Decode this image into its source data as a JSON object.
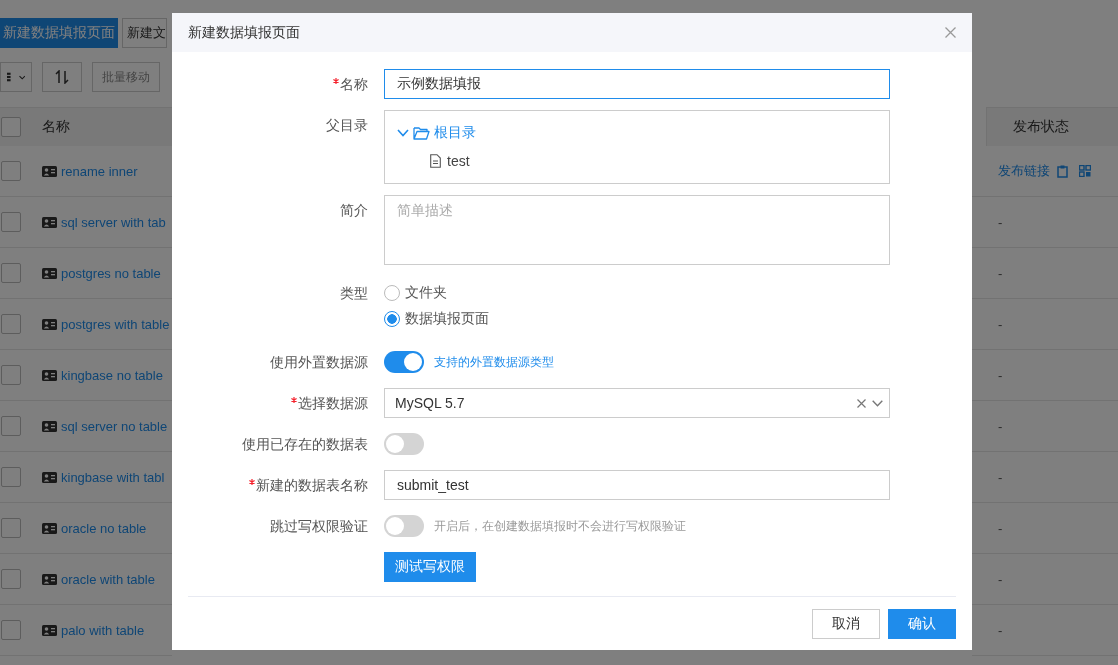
{
  "background": {
    "toolbar_buttons": [
      {
        "label": "新建数据填报页面",
        "kind": "primary"
      },
      {
        "label": "新建文",
        "kind": "default"
      }
    ],
    "action_buttons": [
      {
        "label": "批量移动"
      }
    ],
    "table": {
      "columns": [
        "名称",
        "发布状态"
      ],
      "all_checked": false,
      "rows": [
        {
          "name": "rename inner",
          "status": "发布链接",
          "published": true,
          "checked": false
        },
        {
          "name": "sql server with tab",
          "status": "-",
          "published": false,
          "checked": false
        },
        {
          "name": "postgres no table",
          "status": "-",
          "published": false,
          "checked": false
        },
        {
          "name": "postgres with table",
          "status": "-",
          "published": false,
          "checked": false
        },
        {
          "name": "kingbase no table",
          "status": "-",
          "published": false,
          "checked": false
        },
        {
          "name": "sql server no table",
          "status": "-",
          "published": false,
          "checked": false
        },
        {
          "name": "kingbase with tabl",
          "status": "-",
          "published": false,
          "checked": false
        },
        {
          "name": "oracle no table",
          "status": "-",
          "published": false,
          "checked": false
        },
        {
          "name": "oracle with table",
          "status": "-",
          "published": false,
          "checked": false
        },
        {
          "name": "palo with table",
          "status": "-",
          "published": false,
          "checked": false
        }
      ]
    }
  },
  "dialog": {
    "title": "新建数据填报页面",
    "fields": [
      {
        "kind": "input",
        "label": "名称",
        "required": true,
        "value": "示例数据填报",
        "focused": true
      },
      {
        "kind": "tree",
        "label": "父目录",
        "required": false,
        "tree": [
          {
            "label": "根目录",
            "expanded": true,
            "selected": true,
            "children": [
              {
                "label": "test",
                "selected": false
              }
            ]
          }
        ]
      },
      {
        "kind": "textarea",
        "label": "简介",
        "required": false,
        "placeholder": "简单描述"
      },
      {
        "kind": "radio",
        "label": "类型",
        "required": false,
        "options": [
          {
            "label": "文件夹",
            "selected": false
          },
          {
            "label": "数据填报页面",
            "selected": true
          }
        ]
      },
      {
        "kind": "switch",
        "label": "使用外置数据源",
        "required": false,
        "on": true,
        "link": "支持的外置数据源类型"
      },
      {
        "kind": "select",
        "label": "选择数据源",
        "required": true,
        "value": "MySQL 5.7"
      },
      {
        "kind": "switch",
        "label": "使用已存在的数据表",
        "required": false,
        "on": false
      },
      {
        "kind": "input",
        "label": "新建的数据表名称",
        "required": true,
        "value": "submit_test",
        "focused": false
      },
      {
        "kind": "switch",
        "label": "跳过写权限验证",
        "required": false,
        "on": false,
        "hint": "开启后，在创建数据填报时不会进行写权限验证"
      },
      {
        "kind": "button",
        "text": "测试写权限"
      }
    ],
    "buttons": [
      {
        "label": "取消",
        "kind": "default"
      },
      {
        "label": "确认",
        "kind": "primary"
      }
    ]
  }
}
